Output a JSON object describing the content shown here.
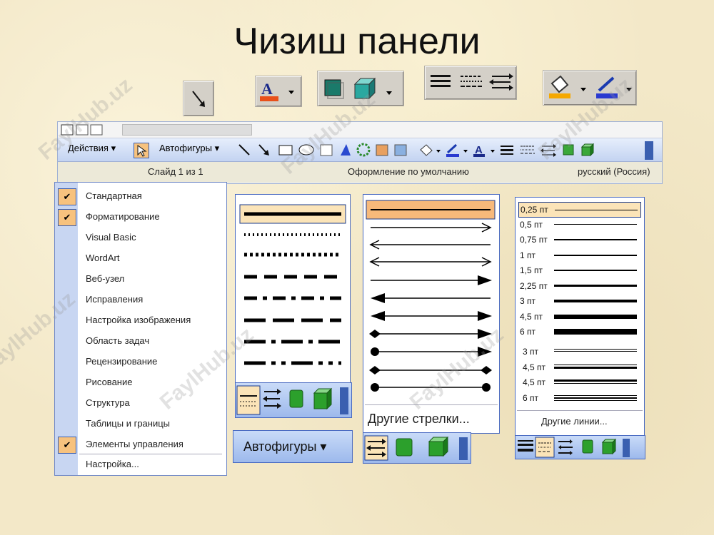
{
  "title": "Чизиш панели",
  "watermark": "FaylHub.uz",
  "statusbar": {
    "slide": "Слайд 1 из 1",
    "design": "Оформление по умолчанию",
    "language": "русский (Россия)"
  },
  "toolbar": {
    "actions_label": "Действия",
    "autoshapes_label": "Автофигуры"
  },
  "menu_items": [
    {
      "label": "Стандартная",
      "checked": true
    },
    {
      "label": "Форматирование",
      "checked": true
    },
    {
      "label": "Visual Basic",
      "checked": false
    },
    {
      "label": "WordArt",
      "checked": false
    },
    {
      "label": "Веб-узел",
      "checked": false
    },
    {
      "label": "Исправления",
      "checked": false
    },
    {
      "label": "Настройка изображения",
      "checked": false
    },
    {
      "label": "Область задач",
      "checked": false
    },
    {
      "label": "Рецензирование",
      "checked": false
    },
    {
      "label": "Рисование",
      "checked": false
    },
    {
      "label": "Структура",
      "checked": false
    },
    {
      "label": "Таблицы и границы",
      "checked": false
    },
    {
      "label": "Элементы управления",
      "checked": true
    }
  ],
  "menu_customize": "Настройка...",
  "autoshapes_button": "Автофигуры",
  "arrows_more": "Другие стрелки...",
  "lines_more": "Другие линии...",
  "line_weights": [
    "0,25 пт",
    "0,5 пт",
    "0,75 пт",
    "1 пт",
    "1,5 пт",
    "2,25 пт",
    "3 пт",
    "4,5 пт",
    "6 пт"
  ],
  "compound_lines": [
    "3 пт",
    "4,5 пт",
    "4,5 пт",
    "6 пт"
  ],
  "colors": {
    "accent_orange": "#f7c27e",
    "toolbar_blue": "#c3d3f1",
    "border_blue": "#4a6bc2"
  }
}
